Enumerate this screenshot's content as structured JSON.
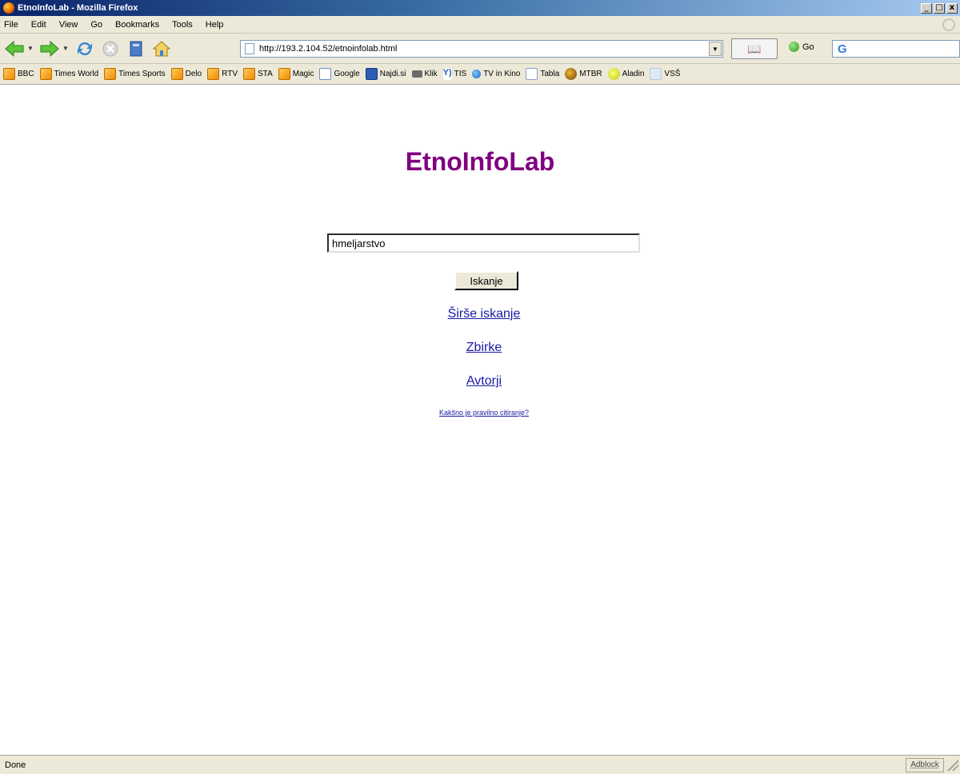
{
  "window": {
    "title": "EtnoInfoLab - Mozilla Firefox"
  },
  "menu": [
    "File",
    "Edit",
    "View",
    "Go",
    "Bookmarks",
    "Tools",
    "Help"
  ],
  "navigation": {
    "url": "http://193.2.104.52/etnoinfolab.html",
    "go_label": "Go"
  },
  "bookmarks": [
    {
      "label": "BBC",
      "icon": "rss-feed-icon"
    },
    {
      "label": "Times World",
      "icon": "rss-feed-icon"
    },
    {
      "label": "Times Sports",
      "icon": "rss-feed-icon"
    },
    {
      "label": "Delo",
      "icon": "rss-feed-icon"
    },
    {
      "label": "RTV",
      "icon": "rss-feed-icon"
    },
    {
      "label": "STA",
      "icon": "rss-feed-icon"
    },
    {
      "label": "Magic",
      "icon": "rss-feed-icon"
    },
    {
      "label": "Google",
      "icon": "google-icon"
    },
    {
      "label": "Najdi.si",
      "icon": "najdi-icon"
    },
    {
      "label": "Klik",
      "icon": "klik-icon"
    },
    {
      "label": "TIS",
      "icon": "tis-icon"
    },
    {
      "label": "TV in Kino",
      "icon": "tv-icon"
    },
    {
      "label": "Tabla",
      "icon": "page-icon"
    },
    {
      "label": "MTBR",
      "icon": "mtbr-icon"
    },
    {
      "label": "Aladin",
      "icon": "aladin-icon"
    },
    {
      "label": "VSŠ",
      "icon": "vss-icon"
    }
  ],
  "page": {
    "title": "EtnoInfoLab",
    "query_value": "hmeljarstvo",
    "search_button": "Iskanje",
    "links": {
      "broader": "Širše iskanje",
      "collections": "Zbirke",
      "authors": "Avtorji",
      "help": "Kakšno je pravilno citiranje?"
    }
  },
  "status": {
    "text": "Done",
    "adblock": "Adblock"
  },
  "colors": {
    "title": "#800080",
    "link": "#1a1aa6",
    "chrome": "#ece9d8"
  }
}
